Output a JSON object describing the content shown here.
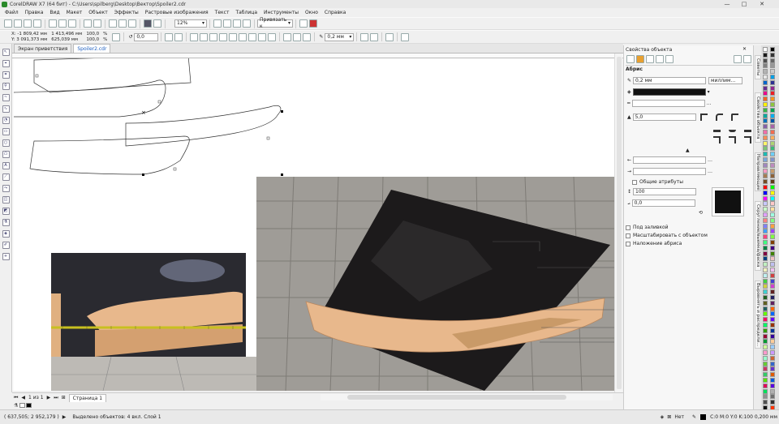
{
  "titlebar": {
    "title": "CorelDRAW X7 (64 бит) - C:\\Users\\spilberg\\Desktop\\Вектор\\Spoiler2.cdr",
    "minimize": "—",
    "maximize": "□",
    "close": "✕"
  },
  "menu": [
    "Файл",
    "Правка",
    "Вид",
    "Макет",
    "Объект",
    "Эффекты",
    "Растровые изображения",
    "Текст",
    "Таблица",
    "Инструменты",
    "Окно",
    "Справка"
  ],
  "toolbar1": {
    "zoom": "12%",
    "snap_label": "Привязать к"
  },
  "toolbar2": {
    "x": "X: -1 809,42 мм",
    "y": "Y: 3 091,373 мм",
    "w": "1 413,496 мм",
    "h": "625,039 мм",
    "scale_x": "100,0",
    "scale_y": "100,0",
    "pct": "%",
    "angle": "0,0",
    "outline_width": "0,2 мм"
  },
  "tabs": [
    "Экран приветствия",
    "Spoiler2.cdr"
  ],
  "pagebar": {
    "page_count": "1 из 1",
    "page_name": "Страница 1"
  },
  "statusbar": {
    "coords": "( 637,505; 2 952,179 )",
    "selection": "Выделено объектов: 4 вкл. Слой 1",
    "fill": "Нет",
    "outline": "C:0 M:0 Y:0 K:100  0,200 мм"
  },
  "docker": {
    "title": "Свойства объекта",
    "section": "Абрис",
    "width": "0,2 мм",
    "units": "миллим...",
    "miter": "5,0",
    "shared_attrs": "Общие атрибуты",
    "stretch": "100",
    "angle": "0,0",
    "behind_fill": "Под заливкой",
    "scale_with_obj": "Масштабировать с объектом",
    "overprint": "Наложение абриса"
  },
  "docker_tabs": [
    "Советы",
    "Свойства объекта",
    "Направляющие",
    "Скругление/выемка/фаска",
    "Выровнять и распредели..."
  ],
  "palette_colors": [
    "#ffffff",
    "#000000",
    "#1a1a1a",
    "#333333",
    "#4d4d4d",
    "#666666",
    "#808080",
    "#999999",
    "#b3b3b3",
    "#cccccc",
    "#e6e6e6",
    "#00a0e6",
    "#0066cc",
    "#2e3192",
    "#662d91",
    "#92278f",
    "#ec008c",
    "#ed1c24",
    "#f26522",
    "#f7941d",
    "#fff200",
    "#8dc63f",
    "#39b54a",
    "#00a651",
    "#00a99d",
    "#00aeef",
    "#0072bc",
    "#0054a6",
    "#8560a8",
    "#a864a8",
    "#f06eaa",
    "#f26c4f",
    "#f68e56",
    "#fbaf5d",
    "#fff568",
    "#acd373",
    "#7cc576",
    "#3cb878",
    "#1cbbb4",
    "#6dcff6",
    "#7da7d9",
    "#8393ca",
    "#a187be",
    "#bd8cbf",
    "#f49ac2",
    "#c69c6d",
    "#a67c52",
    "#8c6239",
    "#754c24",
    "#603913",
    "#ff0000",
    "#00ff00",
    "#0000ff",
    "#ffff00",
    "#ff00ff",
    "#00ffff",
    "#c8c8ff",
    "#ffc8c8",
    "#c8ffc8",
    "#ffe0a0",
    "#e0a0ff",
    "#a0ffe0",
    "#ff8080",
    "#80ff80",
    "#8080ff",
    "#ffa040",
    "#40a0ff",
    "#a040ff",
    "#ff4080",
    "#80ff40",
    "#40ff80",
    "#804000",
    "#008040",
    "#400080",
    "#800040",
    "#408000",
    "#004080",
    "#f0c0c0",
    "#c0f0c0",
    "#c0c0f0",
    "#f0f0c0",
    "#f0c0f0",
    "#c0f0f0",
    "#d04040",
    "#40d040",
    "#4040d0",
    "#d0d040",
    "#d040d0",
    "#40d0d0",
    "#602020",
    "#206020",
    "#202060",
    "#606020",
    "#602060",
    "#206060",
    "#ff6600",
    "#66ff00",
    "#0066ff",
    "#ff0066",
    "#6600ff",
    "#00ff66",
    "#993300",
    "#339900",
    "#003399",
    "#990033",
    "#330099",
    "#009933",
    "#ffcc99",
    "#ccff99",
    "#99ccff",
    "#ff99cc",
    "#cc99ff",
    "#99ffcc",
    "#cc6633",
    "#66cc33",
    "#3366cc",
    "#cc3366",
    "#6633cc",
    "#33cc66",
    "#e05a00",
    "#5ae000",
    "#005ae0",
    "#e0005a",
    "#5a00e0",
    "#00e05a",
    "#b0b0b0",
    "#909090",
    "#707070",
    "#505050",
    "#303030",
    "#101010",
    "#ff3300",
    "#33ff00",
    "#0033ff",
    "#ff0033",
    "#3300ff",
    "#00ff33"
  ]
}
